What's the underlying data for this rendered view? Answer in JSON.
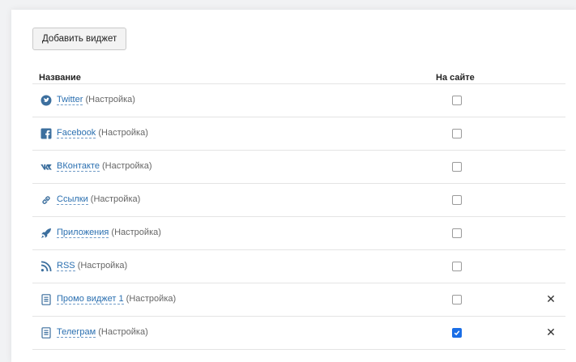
{
  "toolbar": {
    "add_widget_label": "Добавить виджет"
  },
  "table": {
    "col_name": "Название",
    "col_on_site": "На сайте",
    "settings_label": "(Настройка)",
    "remove_symbol": "✕",
    "rows": [
      {
        "name": "Twitter",
        "icon": "twitter-icon",
        "on_site": false,
        "removable": false
      },
      {
        "name": "Facebook",
        "icon": "facebook-icon",
        "on_site": false,
        "removable": false
      },
      {
        "name": "ВКонтакте",
        "icon": "vk-icon",
        "on_site": false,
        "removable": false
      },
      {
        "name": "Ссылки",
        "icon": "link-icon",
        "on_site": false,
        "removable": false
      },
      {
        "name": "Приложения",
        "icon": "rocket-icon",
        "on_site": false,
        "removable": false
      },
      {
        "name": "RSS",
        "icon": "rss-icon",
        "on_site": false,
        "removable": false
      },
      {
        "name": "Промо виджет 1",
        "icon": "document-icon",
        "on_site": false,
        "removable": true
      },
      {
        "name": "Телеграм",
        "icon": "document-icon",
        "on_site": true,
        "removable": true
      }
    ]
  },
  "colors": {
    "icon": "#3c6f9e",
    "link": "#2a6fb0",
    "check_on": "#1b6ee6"
  }
}
